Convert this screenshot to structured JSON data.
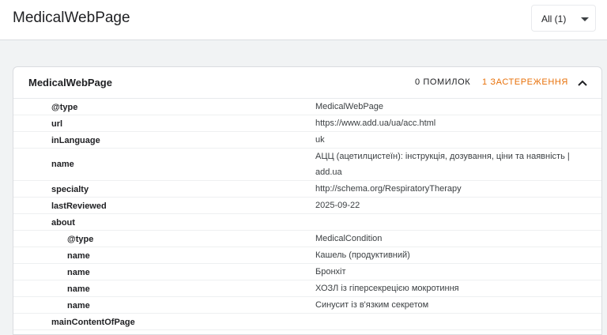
{
  "header": {
    "title": "MedicalWebPage",
    "filter_label": "All (1)"
  },
  "card": {
    "title": "MedicalWebPage",
    "errors_label": "0 ПОМИЛОК",
    "warnings_label": "1 ЗАСТЕРЕЖЕННЯ",
    "collapse_icon": "chevron-up-icon",
    "warning_color": "#e8710a",
    "rows": [
      {
        "prop": "@type",
        "value": "MedicalWebPage"
      },
      {
        "prop": "url",
        "value": "https://www.add.ua/ua/acc.html"
      },
      {
        "prop": "inLanguage",
        "value": "uk"
      },
      {
        "prop": "name",
        "value": "АЦЦ (ацетилцистеїн): інструкція, дозування, ціни та наявність | add.ua"
      },
      {
        "prop": "specialty",
        "value": "http://schema.org/RespiratoryTherapy"
      },
      {
        "prop": "lastReviewed",
        "value": "2025-09-22"
      },
      {
        "prop": "about",
        "value": ""
      },
      {
        "prop": "@type",
        "value": "MedicalCondition"
      },
      {
        "prop": "name",
        "value": "Кашель (продуктивний)"
      },
      {
        "prop": "name",
        "value": "Бронхіт"
      },
      {
        "prop": "name",
        "value": "ХОЗЛ із гіперсекрецією мокротиння"
      },
      {
        "prop": "name",
        "value": "Синусит із в'язким секретом"
      },
      {
        "prop": "mainContentOfPage",
        "value": ""
      }
    ]
  }
}
